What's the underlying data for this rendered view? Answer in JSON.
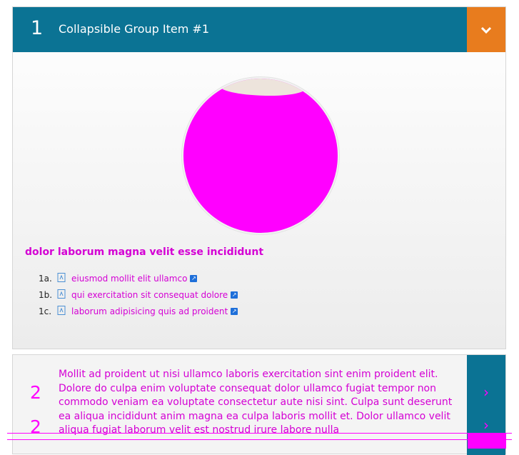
{
  "panel1": {
    "number": "1",
    "title": "Collapsible Group Item #1",
    "toggle_icon": "chevron-down-icon"
  },
  "content": {
    "heading": "dolor laborum magna velit esse incididunt",
    "documents": [
      {
        "num": "1a.",
        "title": "eiusmod mollit elit ullamco"
      },
      {
        "num": "1b.",
        "title": "qui exercitation sit consequat dolore"
      },
      {
        "num": "1c.",
        "title": "laborum adipisicing quis ad proident"
      }
    ]
  },
  "panel2": {
    "number": "2",
    "text": "Mollit ad proident ut nisi ullamco laboris exercitation sint enim proident elit. Dolore do culpa enim voluptate consequat dolor ullamco fugiat tempor non commodo veniam ea voluptate consectetur aute nisi sint. Culpa sunt deserunt ea aliqua incididunt anim magna ea culpa laboris mollit et. Dolor ullamco velit aliqua fugiat laborum velit est nostrud irure labore nulla",
    "toggle_icon": "chevron-right-icon"
  },
  "colors": {
    "header_blue": "#0b7394",
    "toggle_orange": "#e87c1e",
    "magenta": "#ff00ff"
  }
}
